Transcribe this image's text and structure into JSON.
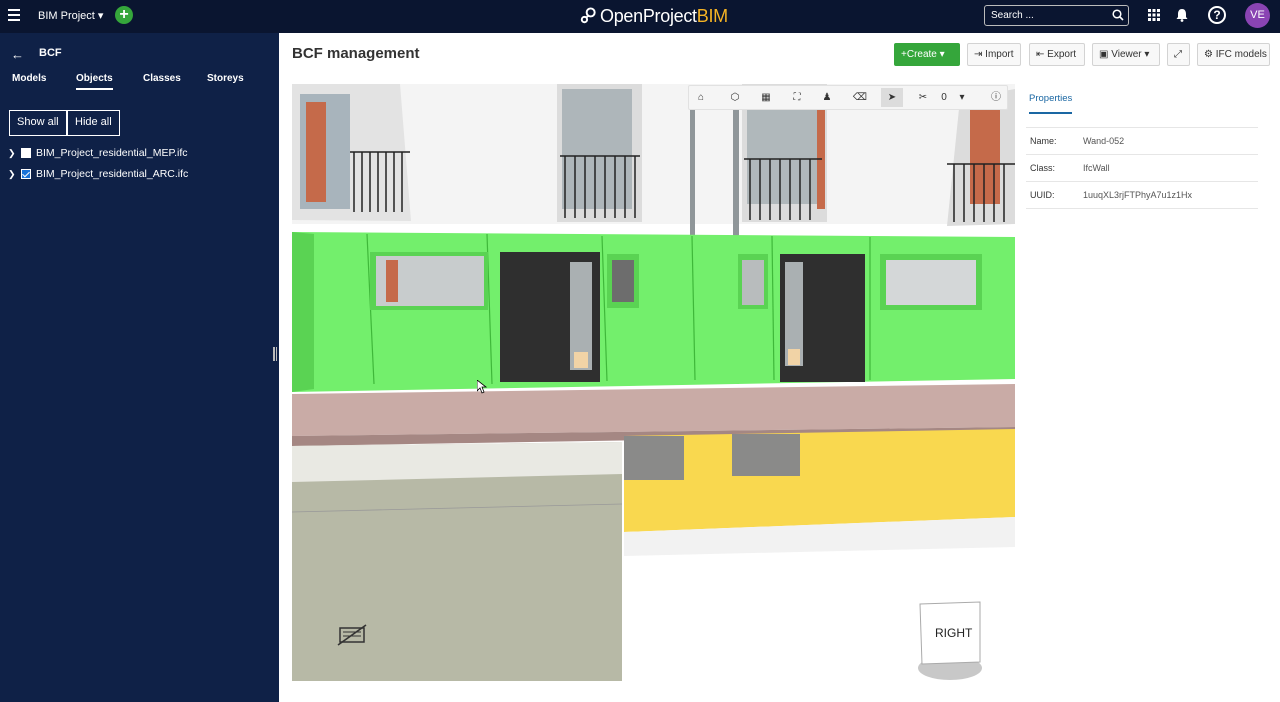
{
  "header": {
    "project_label": "BIM Project",
    "logo_text_main": "OpenProject",
    "logo_text_accent": "BIM",
    "search_placeholder": "Search ...",
    "avatar_initials": "VE",
    "accent_color": "#35a63b",
    "avatar_color": "#8a44b3"
  },
  "sidebar": {
    "back_label": "BCF",
    "tabs": [
      {
        "label": "Models"
      },
      {
        "label": "Objects"
      },
      {
        "label": "Classes"
      },
      {
        "label": "Storeys"
      }
    ],
    "active_tab": "Objects",
    "show_all_label": "Show all",
    "hide_all_label": "Hide all",
    "models": [
      {
        "name": "BIM_Project_residential_MEP.ifc",
        "checked": false
      },
      {
        "name": "BIM_Project_residential_ARC.ifc",
        "checked": true
      }
    ]
  },
  "main": {
    "title": "BCF management",
    "toolbar": {
      "create_label": "Create",
      "import_label": "Import",
      "export_label": "Export",
      "viewer_label": "Viewer",
      "ifc_models_label": "IFC models"
    },
    "viewer_toolbar": {
      "count": "0"
    },
    "viewcube_label": "RIGHT"
  },
  "properties": {
    "tab_label": "Properties",
    "rows": [
      {
        "key": "Name:",
        "value": "Wand-052"
      },
      {
        "key": "Class:",
        "value": "IfcWall"
      },
      {
        "key": "UUID:",
        "value": "1uuqXL3rjFTPhyA7u1z1Hx"
      }
    ]
  }
}
